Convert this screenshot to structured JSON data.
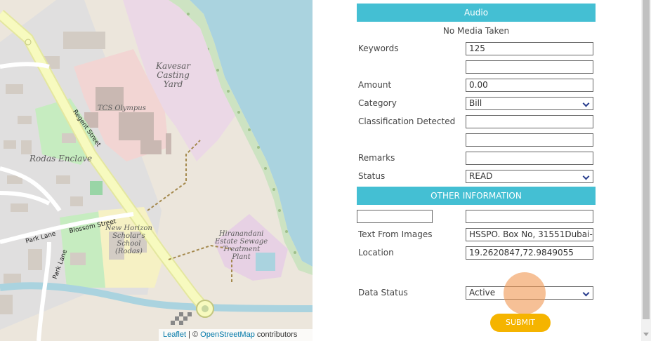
{
  "map": {
    "labels": {
      "kavesar": "Kavesar\nCasting\nYard",
      "tcs": "TCS Olympus",
      "rodas": "Rodas Enclave",
      "school": "New Horizon\nScholar's\nSchool\n(Rodas)",
      "hiranandani": "Hiranandani\nEstate Sewage\nTreatment\nPlant",
      "regent": "Regent Street",
      "blossom": "Blossom Street",
      "parklane1": "Park Lane",
      "parklane2": "Park Lane"
    },
    "attribution": {
      "leaflet": "Leaflet",
      "sep": " | © ",
      "osm": "OpenStreetMap",
      "contrib": " contributors"
    }
  },
  "form": {
    "audio_header": "Audio",
    "no_media": "No Media Taken",
    "keywords_label": "Keywords",
    "keywords_value": "125",
    "amount_label": "Amount",
    "amount_value": "0.00",
    "category_label": "Category",
    "category_value": "Bill",
    "classification_label": "Classification Detected",
    "classification_value": "",
    "remarks_label": "Remarks",
    "remarks_value": "",
    "status_label": "Status",
    "status_value": "READ",
    "other_header": "OTHER INFORMATION",
    "text_images_label": "Text From Images",
    "text_images_value": "HSSPO. Box No, 31551Dubai-",
    "location_label": "Location",
    "location_value": "19.2620847,72.9849055",
    "data_status_label": "Data Status",
    "data_status_value": "Active",
    "submit_label": "SUBMIT"
  },
  "colors": {
    "header_bg": "#44bfd3",
    "submit_bg": "#f5b400",
    "water": "#aad3df",
    "road": "#f7fabf"
  }
}
